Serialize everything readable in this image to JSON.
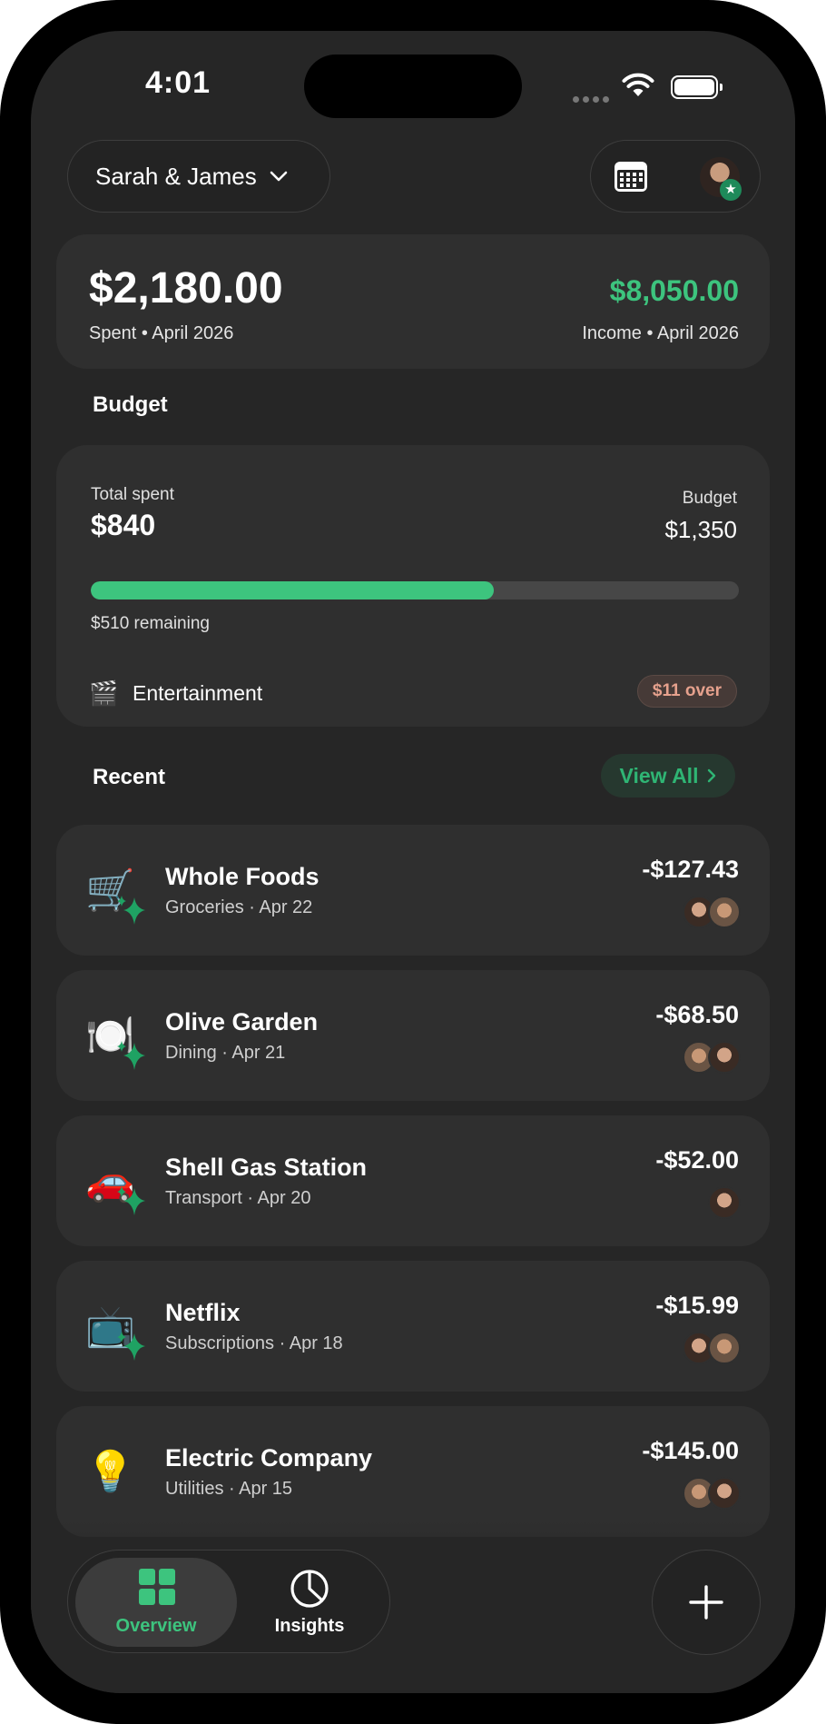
{
  "status_bar": {
    "time": "4:01"
  },
  "header": {
    "account_name": "Sarah & James"
  },
  "summary": {
    "spent_amount": "$2,180.00",
    "spent_label": "Spent • April 2026",
    "income_amount": "$8,050.00",
    "income_label": "Income • April 2026"
  },
  "budget": {
    "section_title": "Budget",
    "total_spent_label": "Total spent",
    "total_spent": "$840",
    "budget_label": "Budget",
    "budget_amount": "$1,350",
    "progress_fraction": 0.622,
    "remaining": "$510 remaining",
    "category": {
      "icon": "🎬",
      "name": "Entertainment",
      "status": "$11 over"
    }
  },
  "recent": {
    "section_title": "Recent",
    "view_all": "View All",
    "transactions": [
      {
        "icon": "🛒",
        "name": "Whole Foods",
        "meta": "Groceries · Apr 22",
        "amount": "-$127.43",
        "avatars": [
          "sarah",
          "james"
        ]
      },
      {
        "icon": "🍽️",
        "name": "Olive Garden",
        "meta": "Dining · Apr 21",
        "amount": "-$68.50",
        "avatars": [
          "james",
          "sarah"
        ]
      },
      {
        "icon": "🚗",
        "name": "Shell Gas Station",
        "meta": "Transport · Apr 20",
        "amount": "-$52.00",
        "avatars": [
          "sarah"
        ]
      },
      {
        "icon": "📺",
        "name": "Netflix",
        "meta": "Subscriptions · Apr 18",
        "amount": "-$15.99",
        "avatars": [
          "sarah",
          "james"
        ]
      },
      {
        "icon": "💡",
        "name": "Electric Company",
        "meta": "Utilities · Apr 15",
        "amount": "-$145.00",
        "avatars": [
          "james",
          "sarah"
        ]
      }
    ]
  },
  "tabs": {
    "overview": "Overview",
    "insights": "Insights"
  },
  "colors": {
    "accent_green": "#3dc47e",
    "card_bg": "#2f2f2f",
    "screen_bg": "#262626",
    "over_badge": "#e6a18d"
  }
}
